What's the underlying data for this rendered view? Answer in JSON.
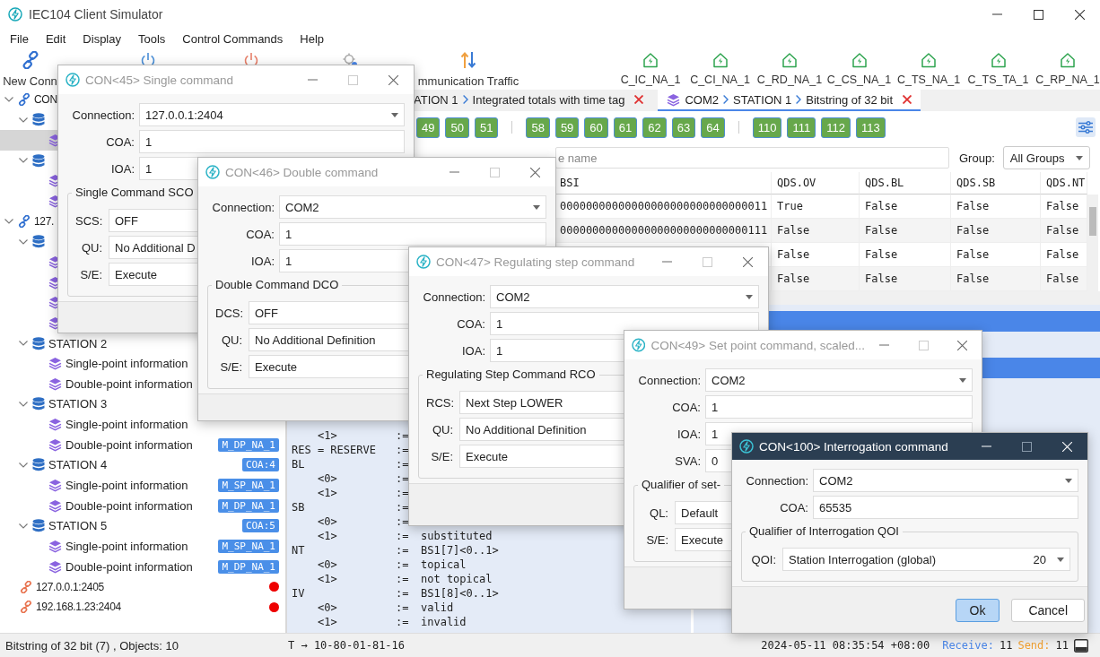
{
  "window": {
    "title": "IEC104 Client Simulator"
  },
  "menu": [
    "File",
    "Edit",
    "Display",
    "Tools",
    "Control Commands",
    "Help"
  ],
  "toolbar": {
    "items": [
      {
        "kind": "new",
        "label": "New Conn"
      },
      {
        "kind": "connect"
      },
      {
        "kind": "disconnect"
      },
      {
        "kind": "settings"
      },
      {
        "kind": "traffic",
        "label": "mmunication Traffic"
      }
    ],
    "commands": [
      "C_IC_NA_1",
      "C_CI_NA_1",
      "C_RD_NA_1",
      "C_CS_NA_1",
      "C_TS_NA_1",
      "C_TS_TA_1",
      "C_RP_NA_1"
    ]
  },
  "tree": [
    {
      "kind": "connection",
      "label": "CON",
      "connected": true,
      "expanded": true,
      "selected": false,
      "children": [
        {
          "kind": "station",
          "expanded": true,
          "selected": false,
          "children": [
            {
              "kind": "dataset",
              "selected": true
            }
          ]
        },
        {
          "kind": "station",
          "expanded": true,
          "selected": false,
          "children": [
            {
              "kind": "dataset",
              "selected": false
            },
            {
              "kind": "dataset",
              "selected": false
            }
          ]
        }
      ]
    },
    {
      "kind": "connection",
      "label": "127.",
      "connected": true,
      "expanded": true,
      "selected": false,
      "children": [
        {
          "kind": "station",
          "expanded": true,
          "selected": false,
          "children": [
            {
              "kind": "dataset",
              "selected": false
            },
            {
              "kind": "dataset",
              "selected": false
            },
            {
              "kind": "dataset",
              "selected": false
            },
            {
              "kind": "dataset",
              "selected": false
            }
          ]
        },
        {
          "kind": "station",
          "label": "STATION 2",
          "expanded": true,
          "selected": false,
          "children": [
            {
              "kind": "dataset",
              "label": "Single-point information",
              "selected": false
            },
            {
              "kind": "dataset",
              "label": "Double-point information",
              "selected": false
            }
          ]
        },
        {
          "kind": "station",
          "label": "STATION 3",
          "expanded": true,
          "selected": false,
          "children": [
            {
              "kind": "dataset",
              "label": "Single-point information",
              "selected": false
            },
            {
              "kind": "dataset",
              "label": "Double-point information",
              "badge": "M_DP_NA_1",
              "selected": false
            }
          ]
        },
        {
          "kind": "station",
          "label": "STATION 4",
          "badge": "COA:4",
          "expanded": true,
          "selected": false,
          "children": [
            {
              "kind": "dataset",
              "label": "Single-point information",
              "badge": "M_SP_NA_1",
              "selected": false
            },
            {
              "kind": "dataset",
              "label": "Double-point information",
              "badge": "M_DP_NA_1",
              "selected": false
            }
          ]
        },
        {
          "kind": "station",
          "label": "STATION 5",
          "badge": "COA:5",
          "expanded": true,
          "selected": false,
          "children": [
            {
              "kind": "dataset",
              "label": "Single-point information",
              "badge": "M_SP_NA_1",
              "selected": false
            },
            {
              "kind": "dataset",
              "label": "Double-point information",
              "badge": "M_DP_NA_1",
              "selected": false
            }
          ]
        }
      ]
    },
    {
      "kind": "connection",
      "label": "127.0.0.1:2405",
      "connected": false,
      "selected": false
    },
    {
      "kind": "connection",
      "label": "192.168.1.23:2404",
      "connected": false,
      "selected": false
    }
  ],
  "tabs": [
    {
      "crumbs": [
        "ATION 1",
        "Integrated totals with time tag"
      ],
      "selected": false
    },
    {
      "kind": "dataset",
      "crumbs": [
        "COM2",
        "STATION 1",
        "Bitstring of 32 bit"
      ],
      "selected": true
    }
  ],
  "chip_groups": [
    [
      "49",
      "50",
      "51"
    ],
    [
      "58",
      "59",
      "60",
      "61",
      "62",
      "63",
      "64"
    ],
    [
      "110",
      "111",
      "112",
      "113"
    ]
  ],
  "filter": {
    "placeholder": "e name",
    "group_label": "Group:",
    "group_value": "All Groups"
  },
  "table": {
    "columns": [
      "BSI",
      "QDS.OV",
      "QDS.BL",
      "QDS.SB",
      "QDS.NT"
    ],
    "rows": [
      {
        "bsi": "00000000000000000000000000000011",
        "flags": [
          "True",
          "False",
          "False",
          "False"
        ]
      },
      {
        "bsi": "00000000000000000000000000000111",
        "flags": [
          "False",
          "False",
          "False",
          "False"
        ]
      },
      {
        "flags": [
          "False",
          "False",
          "False",
          "False"
        ]
      },
      {
        "flags": [
          "False",
          "False",
          "False",
          "False"
        ]
      }
    ]
  },
  "packet_list": [
    {
      "selected": true
    },
    {
      "selected": false
    },
    {
      "selected": true
    }
  ],
  "description": [
    {
      "kind": "value",
      "key": "<1>",
      "op": ":="
    },
    {
      "kind": "field",
      "key": "RES = RESERVE",
      "op": ":="
    },
    {
      "kind": "field",
      "key": "BL",
      "op": ":="
    },
    {
      "kind": "value",
      "key": "<0>",
      "op": ":="
    },
    {
      "kind": "value",
      "key": "<1>",
      "op": ":="
    },
    {
      "kind": "field",
      "key": "SB",
      "op": ":="
    },
    {
      "kind": "value",
      "key": "<0>",
      "op": ":="
    },
    {
      "kind": "value",
      "key": "<1>",
      "op": ":=",
      "value": "substituted"
    },
    {
      "kind": "field",
      "key": "NT",
      "op": ":=",
      "value": "BS1[7]<0..1>"
    },
    {
      "kind": "value",
      "key": "<0>",
      "op": ":=",
      "value": "topical"
    },
    {
      "kind": "value",
      "key": "<1>",
      "op": ":=",
      "value": "not topical"
    },
    {
      "kind": "field",
      "key": "IV",
      "op": ":=",
      "value": "BS1[8]<0..1>"
    },
    {
      "kind": "value",
      "key": "<0>",
      "op": ":=",
      "value": "valid"
    },
    {
      "kind": "value",
      "key": "<1>",
      "op": ":=",
      "value": "invalid"
    }
  ],
  "status_bar": {
    "summary": "Bitstring of 32 bit (7) , Objects: 10",
    "trace": "T → 10-80-01-81-16",
    "time": "2024-05-11 08:35:54 +08:00",
    "receive_label": "Receive:",
    "receive": "11",
    "send_label": "Send:",
    "send": "11"
  },
  "dialogs": [
    {
      "title": "CON<45> Single command",
      "active": false,
      "fields": [
        {
          "label": "Connection:",
          "value": "127.0.0.1:2404",
          "kind": "dropdown"
        },
        {
          "label": "COA:",
          "value": "1",
          "kind": "text"
        },
        {
          "label": "IOA:",
          "value": "1",
          "kind": "text"
        }
      ],
      "group": {
        "title": "Single Command SCO",
        "fields": [
          {
            "label": "SCS:",
            "value": "OFF",
            "kind": "text"
          },
          {
            "label": "QU:",
            "value": "No Additional D",
            "kind": "text"
          },
          {
            "label": "S/E:",
            "value": "Execute",
            "kind": "text"
          }
        ]
      }
    },
    {
      "title": "CON<46> Double command",
      "active": false,
      "fields": [
        {
          "label": "Connection:",
          "value": "COM2",
          "kind": "dropdown"
        },
        {
          "label": "COA:",
          "value": "1",
          "kind": "text"
        },
        {
          "label": "IOA:",
          "value": "1",
          "kind": "text"
        }
      ],
      "group": {
        "title": "Double Command DCO",
        "fields": [
          {
            "label": "DCS:",
            "value": "OFF",
            "kind": "text"
          },
          {
            "label": "QU:",
            "value": "No Additional Definition",
            "kind": "text"
          },
          {
            "label": "S/E:",
            "value": "Execute",
            "kind": "text"
          }
        ]
      }
    },
    {
      "title": "CON<47> Regulating step command",
      "active": false,
      "fields": [
        {
          "label": "Connection:",
          "value": "COM2",
          "kind": "dropdown"
        },
        {
          "label": "COA:",
          "value": "1",
          "kind": "text"
        },
        {
          "label": "IOA:",
          "value": "1",
          "kind": "text"
        }
      ],
      "group": {
        "title": "Regulating Step Command RCO",
        "fields": [
          {
            "label": "RCS:",
            "value": "Next Step LOWER",
            "kind": "text"
          },
          {
            "label": "QU:",
            "value": "No Additional Definition",
            "kind": "text"
          },
          {
            "label": "S/E:",
            "value": "Execute",
            "kind": "text"
          }
        ]
      }
    },
    {
      "title": "CON<49> Set point command, scaled...",
      "active": false,
      "fields": [
        {
          "label": "Connection:",
          "value": "COM2",
          "kind": "dropdown"
        },
        {
          "label": "COA:",
          "value": "1",
          "kind": "text"
        },
        {
          "label": "IOA:",
          "value": "1",
          "kind": "text"
        },
        {
          "label": "SVA:",
          "value": "0",
          "kind": "text"
        }
      ],
      "group": {
        "title": "Qualifier of set-",
        "fields": [
          {
            "label": "QL:",
            "value": "Default",
            "kind": "text"
          },
          {
            "label": "S/E:",
            "value": "Execute",
            "kind": "text"
          }
        ]
      }
    },
    {
      "title": "CON<100> Interrogation command",
      "active": true,
      "fields": [
        {
          "label": "Connection:",
          "value": "COM2",
          "kind": "dropdown"
        },
        {
          "label": "COA:",
          "value": "65535",
          "kind": "text"
        }
      ],
      "group": {
        "title": "Qualifier of Interrogation QOI",
        "fields": [
          {
            "label": "QOI:",
            "value": "Station Interrogation (global)",
            "code": "20",
            "kind": "dropdown"
          }
        ]
      },
      "buttons": [
        {
          "label": "Ok",
          "default": true
        },
        {
          "label": "Cancel",
          "default": false
        }
      ]
    }
  ]
}
